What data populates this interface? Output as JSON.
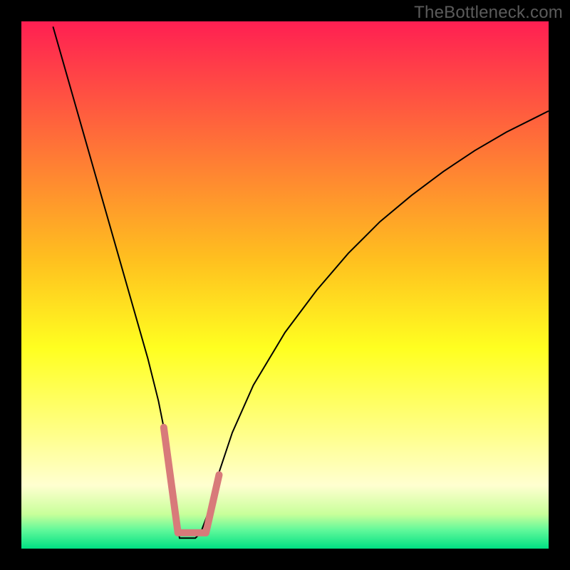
{
  "watermark": "TheBottleneck.com",
  "chart_data": {
    "type": "line",
    "title": "",
    "xlabel": "",
    "ylabel": "",
    "xlim": [
      0,
      100
    ],
    "ylim": [
      0,
      100
    ],
    "grid": false,
    "legend": false,
    "background_gradient": {
      "stops": [
        {
          "pos": 0.0,
          "color": "#ff1f52"
        },
        {
          "pos": 0.45,
          "color": "#ffbf1f"
        },
        {
          "pos": 0.62,
          "color": "#ffff20"
        },
        {
          "pos": 0.78,
          "color": "#ffff88"
        },
        {
          "pos": 0.88,
          "color": "#ffffd0"
        },
        {
          "pos": 0.935,
          "color": "#c8ff9a"
        },
        {
          "pos": 0.965,
          "color": "#60f89a"
        },
        {
          "pos": 1.0,
          "color": "#00e083"
        }
      ]
    },
    "series": [
      {
        "name": "curve",
        "stroke": "#000000",
        "stroke_width": 2,
        "x": [
          6,
          8,
          10,
          12,
          14,
          16,
          18,
          20,
          22,
          24,
          26,
          27,
          28,
          29,
          29.5,
          30,
          31,
          32,
          33,
          34,
          35.5,
          37,
          40,
          44,
          50,
          56,
          62,
          68,
          74,
          80,
          86,
          92,
          98,
          100
        ],
        "y": [
          99,
          92,
          85,
          78,
          71,
          64,
          57,
          50,
          43,
          36,
          28,
          23,
          17,
          10,
          5,
          2,
          2,
          2,
          2,
          3,
          7,
          13,
          22,
          31,
          41,
          49,
          56,
          62,
          67,
          71.5,
          75.5,
          79,
          82,
          83
        ]
      },
      {
        "name": "highlight",
        "stroke": "#d87a7a",
        "stroke_width": 10,
        "linecap": "round",
        "segments": [
          {
            "x": [
              27.0,
              29.7
            ],
            "y": [
              23.0,
              3.0
            ]
          },
          {
            "x": [
              29.7,
              35.0
            ],
            "y": [
              3.0,
              3.0
            ]
          },
          {
            "x": [
              35.0,
              37.5
            ],
            "y": [
              3.0,
              14.0
            ]
          }
        ]
      }
    ]
  }
}
